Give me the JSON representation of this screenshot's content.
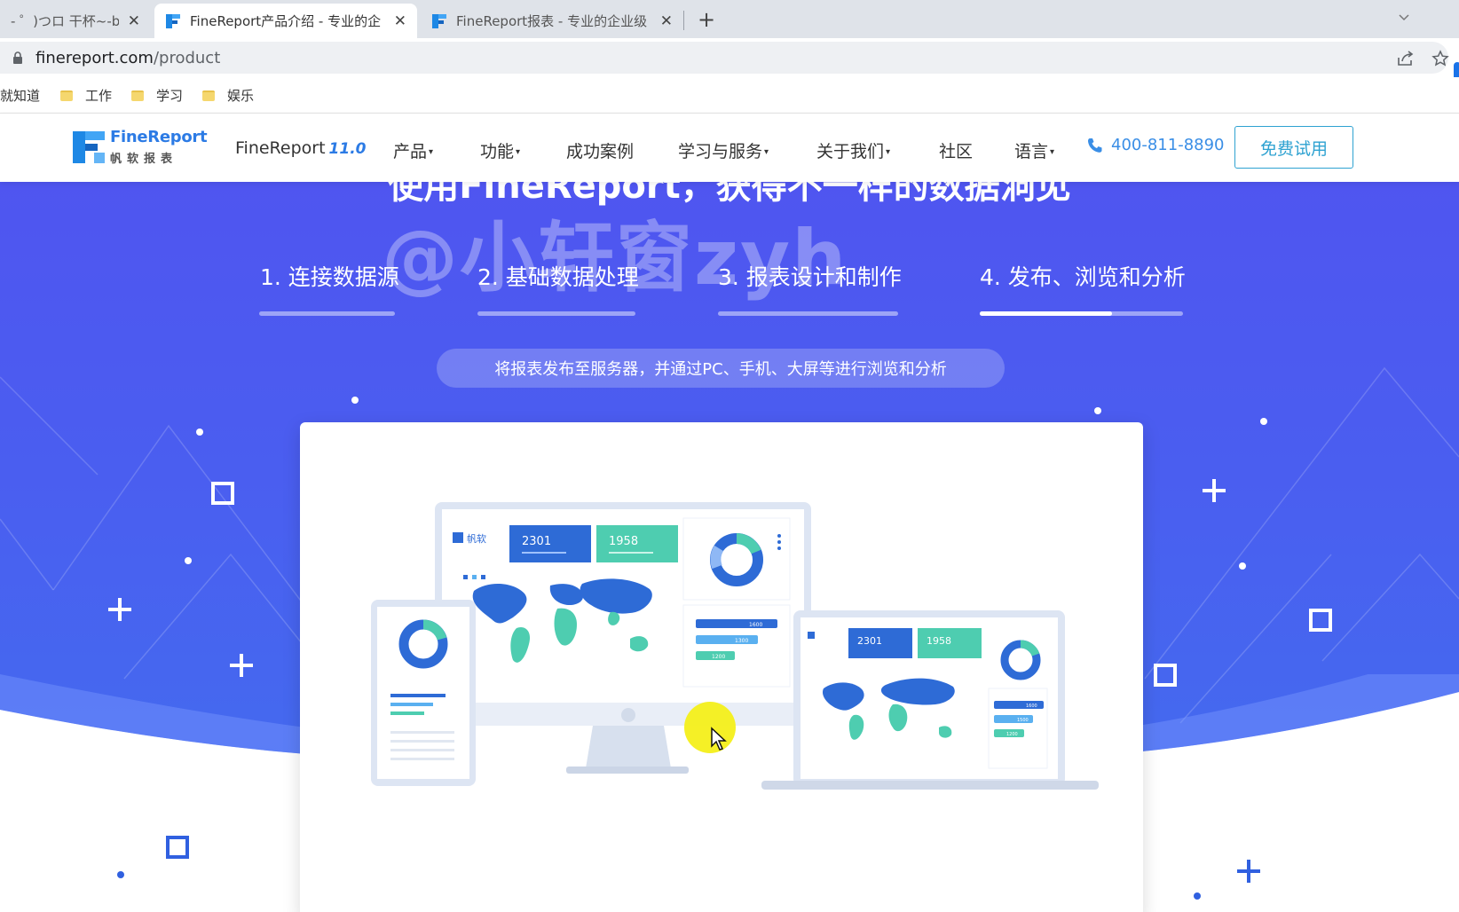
{
  "browser": {
    "tabs": [
      {
        "title": "- ゜)つロ 干杯~-bilil",
        "active": false
      },
      {
        "title": "FineReport产品介绍 - 专业的企",
        "active": true
      },
      {
        "title": "FineReport报表 - 专业的企业级",
        "active": false
      }
    ],
    "close_symbol": "✕",
    "new_tab_symbol": "+",
    "url_host": "finereport.com",
    "url_path": "/product",
    "bookmarks": [
      "就知道",
      "工作",
      "学习",
      "娱乐"
    ]
  },
  "header": {
    "logo_en": "FineReport",
    "logo_cn": "帆软报表",
    "product_name": "FineReport",
    "product_version": "11.0",
    "nav": [
      "产品",
      "功能",
      "成功案例",
      "学习与服务",
      "关于我们",
      "社区",
      "语言"
    ],
    "phone": "400-811-8890",
    "trial_button": "免费试用"
  },
  "hero": {
    "title": "使用FineReport，获得不一样的数据洞见",
    "watermark": "@小轩窗zyh",
    "steps": [
      {
        "label": "1. 连接数据源",
        "progress": 0
      },
      {
        "label": "2. 基础数据处理",
        "progress": 0
      },
      {
        "label": "3. 报表设计和制作",
        "progress": 0
      },
      {
        "label": "4. 发布、浏览和分析",
        "progress": 0.65
      }
    ],
    "active_step": 4,
    "description": "将报表发布至服务器，并通过PC、手机、大屏等进行浏览和分析"
  },
  "showcase": {
    "brand": "帆软",
    "metrics": [
      "2301",
      "1958"
    ],
    "bar_labels": [
      "1600",
      "1300",
      "1200"
    ],
    "laptop_bar_labels": [
      "1600",
      "1500",
      "1200"
    ]
  },
  "colors": {
    "hero_bg": "#4a5ef0",
    "accent": "#2c7be5",
    "metric_blue": "#2e6bd6",
    "metric_teal": "#4ecdb0"
  }
}
